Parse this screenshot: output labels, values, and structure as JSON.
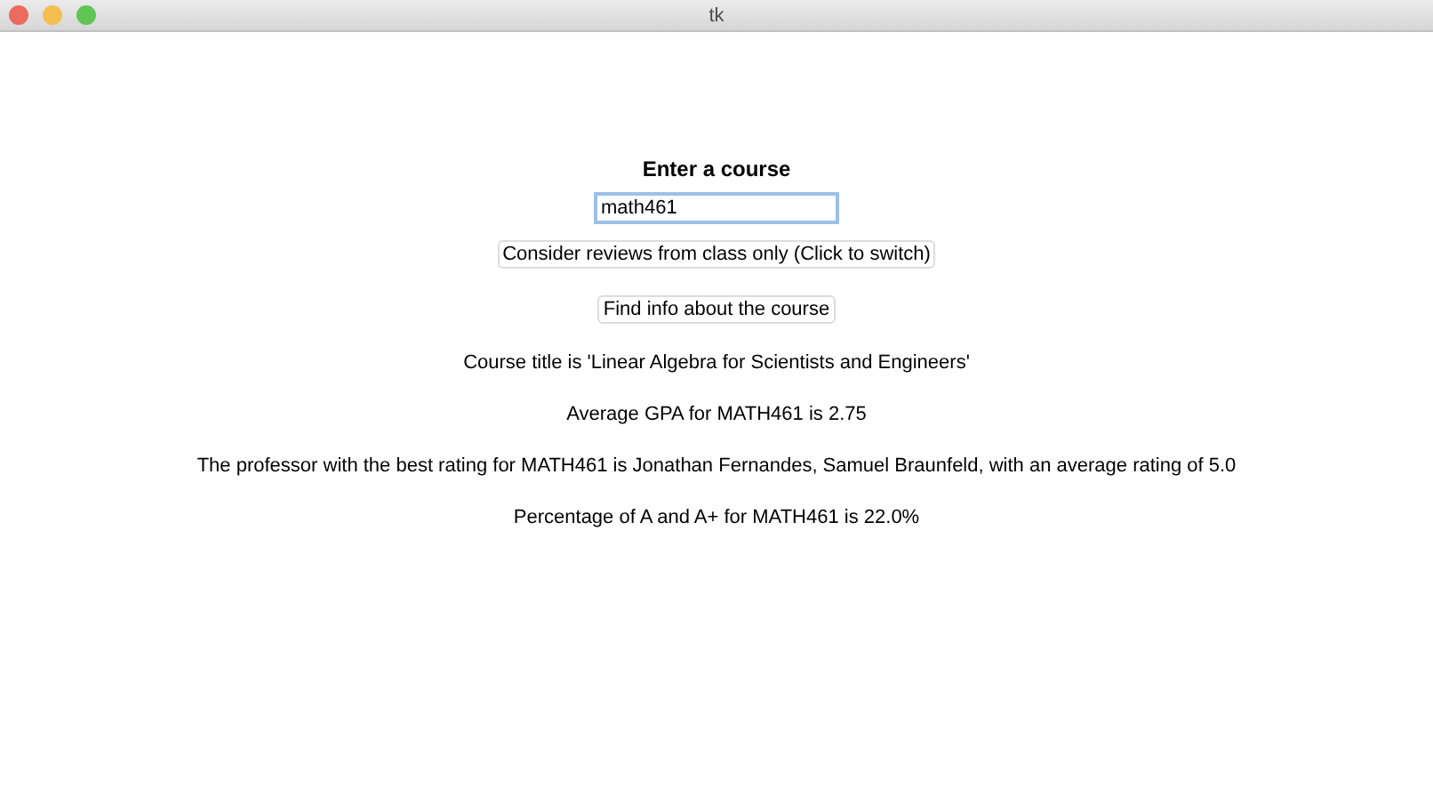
{
  "window": {
    "title": "tk"
  },
  "heading": "Enter a course",
  "course_field": {
    "value": "math461",
    "focused": true
  },
  "buttons": [
    "Consider reviews from class only (Click to switch)",
    "Find info about the course"
  ],
  "results": [
    "Course title is 'Linear Algebra for Scientists and Engineers'",
    "Average GPA for MATH461 is 2.75",
    "The professor with the best rating for MATH461 is Jonathan Fernandes, Samuel Braunfeld, with an average rating of 5.0",
    "Percentage of A and A+ for MATH461 is 22.0%"
  ]
}
